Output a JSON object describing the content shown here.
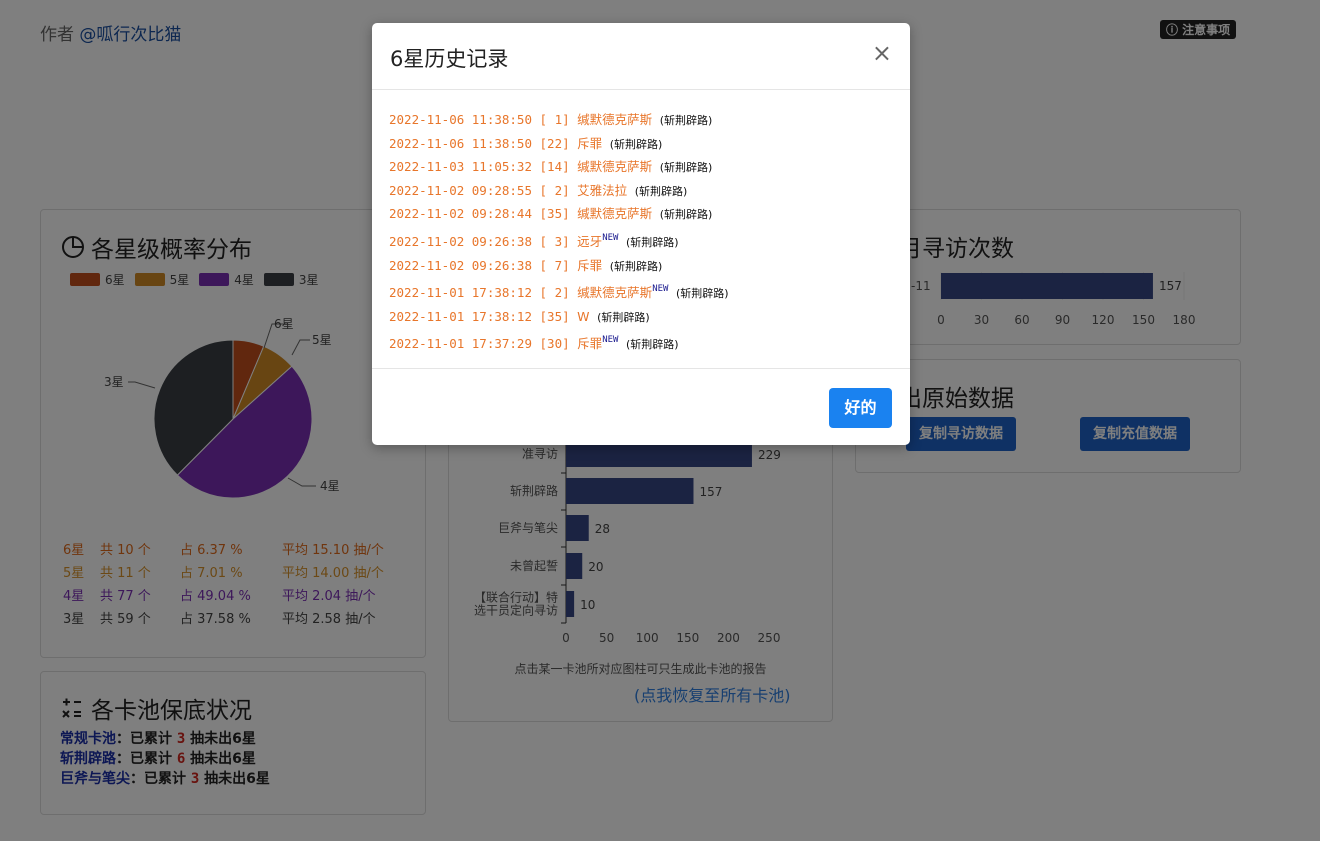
{
  "header": {
    "author_prefix": "作者 ",
    "author_name": "@呱行次比猫",
    "notice_label": "ⓘ 注意事项"
  },
  "star_card": {
    "title": "各星级概率分布",
    "legend": [
      {
        "label": "6星",
        "color": "#c24f1c"
      },
      {
        "label": "5星",
        "color": "#d18a24"
      },
      {
        "label": "4星",
        "color": "#7b2fb5"
      },
      {
        "label": "3星",
        "color": "#3a3f44"
      }
    ],
    "pie_labels": {
      "six": "6星",
      "five": "5星",
      "four": "4星",
      "three": "3星"
    },
    "stats": [
      {
        "star": "6星",
        "count": "共 10 个",
        "pct": "占 6.37 %",
        "avg": "平均 15.10 抽/个",
        "color": "#e06a1b"
      },
      {
        "star": "5星",
        "count": "共 11 个",
        "pct": "占 7.01 %",
        "avg": "平均 14.00 抽/个",
        "color": "#d8932a"
      },
      {
        "star": "4星",
        "count": "共 77 个",
        "pct": "占 49.04 %",
        "avg": "平均 2.04 抽/个",
        "color": "#7b2fb5"
      },
      {
        "star": "3星",
        "count": "共 59 个",
        "pct": "占 37.58 %",
        "avg": "平均 2.58 抽/个",
        "color": "#444444"
      }
    ]
  },
  "pool_card": {
    "title": "各卡池保底状况",
    "rows": [
      {
        "name": "常规卡池",
        "mid": "：已累计 ",
        "num": "3",
        "tail": " 抽未出6星"
      },
      {
        "name": "斩荆辟路",
        "mid": "：已累计 ",
        "num": "6",
        "tail": " 抽未出6星"
      },
      {
        "name": "巨斧与笔尖",
        "mid": "：已累计 ",
        "num": "3",
        "tail": " 抽未出6星"
      }
    ]
  },
  "pool_chart": {
    "visible_partial_label": "常驻标\n准寻访",
    "categories": [
      "常驻标准寻访",
      "斩荆辟路",
      "巨斧与笔尖",
      "未曾起誓",
      "【联合行动】特选干员定向寻访"
    ],
    "cat_lines": [
      [
        "准寻访"
      ],
      [
        "斩荆辟路"
      ],
      [
        "巨斧与笔尖"
      ],
      [
        "未曾起誓"
      ],
      [
        "【联合行动】特",
        "选干员定向寻访"
      ]
    ],
    "values": [
      229,
      157,
      28,
      20,
      10
    ],
    "ticks": [
      "0",
      "50",
      "100",
      "150",
      "200",
      "250"
    ],
    "hint": "点击某一卡池所对应图柱可只生成此卡池的报告",
    "restore_link": "(点我恢复至所有卡池)"
  },
  "monthly_card": {
    "title": "每月寻访次数",
    "category_label": "-11",
    "value": 157,
    "ticks": [
      "0",
      "30",
      "60",
      "90",
      "120",
      "150",
      "180"
    ]
  },
  "export_card": {
    "title": "导出原始数据",
    "btn_gacha": "复制寻访数据",
    "btn_pay": "复制充值数据"
  },
  "modal": {
    "title": "6星历史记录",
    "close": "×",
    "ok": "好的",
    "records": [
      {
        "ts": "2022-11-06 11:38:50",
        "idx": "[ 1]",
        "name": "缄默德克萨斯",
        "new": "",
        "pool": "(斩荆辟路)"
      },
      {
        "ts": "2022-11-06 11:38:50",
        "idx": "[22]",
        "name": "斥罪",
        "new": "",
        "pool": "(斩荆辟路)"
      },
      {
        "ts": "2022-11-03 11:05:32",
        "idx": "[14]",
        "name": "缄默德克萨斯",
        "new": "",
        "pool": "(斩荆辟路)"
      },
      {
        "ts": "2022-11-02 09:28:55",
        "idx": "[ 2]",
        "name": "艾雅法拉",
        "new": "",
        "pool": "(斩荆辟路)"
      },
      {
        "ts": "2022-11-02 09:28:44",
        "idx": "[35]",
        "name": "缄默德克萨斯",
        "new": "",
        "pool": "(斩荆辟路)"
      },
      {
        "ts": "2022-11-02 09:26:38",
        "idx": "[ 3]",
        "name": "远牙",
        "new": "NEW",
        "pool": "(斩荆辟路)"
      },
      {
        "ts": "2022-11-02 09:26:38",
        "idx": "[ 7]",
        "name": "斥罪",
        "new": "",
        "pool": "(斩荆辟路)"
      },
      {
        "ts": "2022-11-01 17:38:12",
        "idx": "[ 2]",
        "name": "缄默德克萨斯",
        "new": "NEW",
        "pool": "(斩荆辟路)"
      },
      {
        "ts": "2022-11-01 17:38:12",
        "idx": "[35]",
        "name": "W",
        "new": "",
        "pool": "(斩荆辟路)"
      },
      {
        "ts": "2022-11-01 17:37:29",
        "idx": "[30]",
        "name": "斥罪",
        "new": "NEW",
        "pool": "(斩荆辟路)"
      }
    ]
  }
}
